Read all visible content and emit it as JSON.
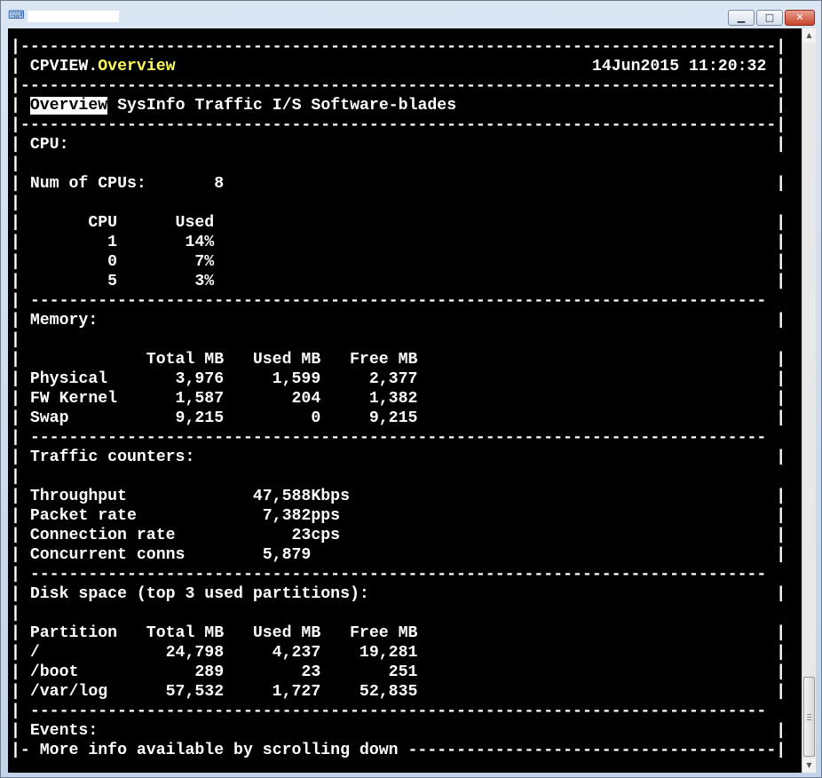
{
  "window": {
    "title": "",
    "app_icon": "putty-icon",
    "controls": {
      "minimize": "▁",
      "maximize": "□",
      "close": "✕"
    }
  },
  "header": {
    "app_name": "CPVIEW.",
    "view_name": "Overview",
    "datetime": "14Jun2015 11:20:32"
  },
  "tabs": [
    {
      "label": "Overview",
      "active": true
    },
    {
      "label": "SysInfo"
    },
    {
      "label": "Traffic"
    },
    {
      "label": "I/S"
    },
    {
      "label": "Software-blades"
    }
  ],
  "cpu": {
    "title": "CPU:",
    "num_label": "Num of CPUs:",
    "num_value": "8",
    "col_cpu": "CPU",
    "col_used": "Used",
    "rows": [
      {
        "cpu": "1",
        "used": "14%"
      },
      {
        "cpu": "0",
        "used": "7%"
      },
      {
        "cpu": "5",
        "used": "3%"
      }
    ]
  },
  "memory": {
    "title": "Memory:",
    "columns": [
      "Total MB",
      "Used MB",
      "Free MB"
    ],
    "rows": [
      {
        "name": "Physical",
        "total": "3,976",
        "used": "1,599",
        "free": "2,377"
      },
      {
        "name": "FW Kernel",
        "total": "1,587",
        "used": "204",
        "free": "1,382"
      },
      {
        "name": "Swap",
        "total": "9,215",
        "used": "0",
        "free": "9,215"
      }
    ]
  },
  "traffic": {
    "title": "Traffic counters:",
    "rows": [
      {
        "label": "Throughput",
        "value": "47,588Kbps"
      },
      {
        "label": "Packet rate",
        "value": "7,382pps"
      },
      {
        "label": "Connection rate",
        "value": "23cps"
      },
      {
        "label": "Concurrent conns",
        "value": "5,879"
      }
    ]
  },
  "disk": {
    "title": "Disk space (top 3 used partitions):",
    "columns": [
      "Partition",
      "Total MB",
      "Used MB",
      "Free MB"
    ],
    "rows": [
      {
        "name": "/",
        "total": "24,798",
        "used": "4,237",
        "free": "19,281"
      },
      {
        "name": "/boot",
        "total": "289",
        "used": "23",
        "free": "251"
      },
      {
        "name": "/var/log",
        "total": "57,532",
        "used": "1,727",
        "free": "52,835"
      }
    ]
  },
  "events": {
    "title": "Events:",
    "more_info": "More info available by scrolling down"
  }
}
